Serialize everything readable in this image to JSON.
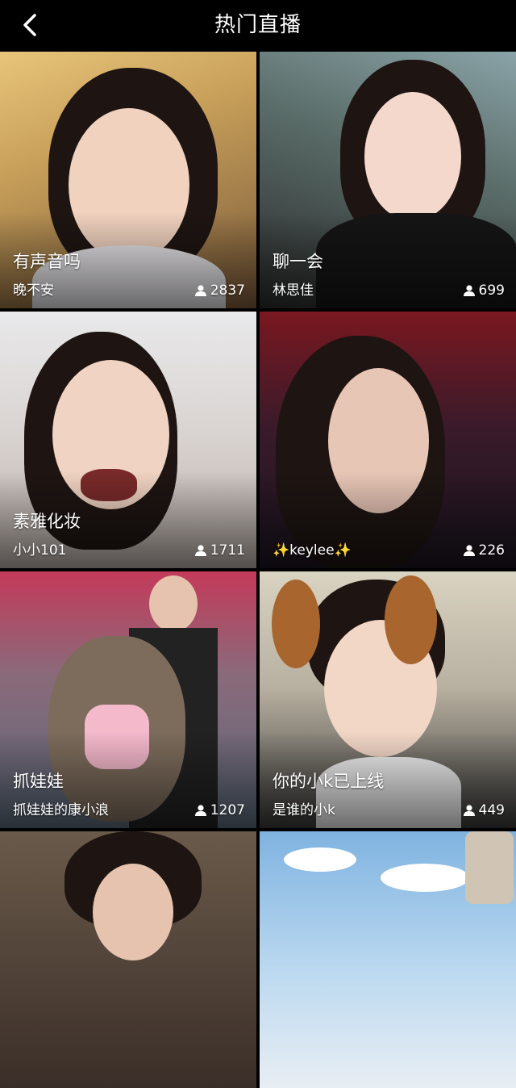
{
  "header": {
    "title": "热门直播",
    "back_icon": "chevron-left-icon"
  },
  "cards": [
    {
      "title": "有声音吗",
      "host": "晚不安",
      "viewers": "2837"
    },
    {
      "title": "聊一会",
      "host": "林思佳",
      "viewers": "699"
    },
    {
      "title": "素雅化妆",
      "host": "小小101",
      "viewers": "1711"
    },
    {
      "title": "",
      "host": "✨keylee✨",
      "viewers": "226"
    },
    {
      "title": "抓娃娃",
      "host": "抓娃娃的康小浪",
      "viewers": "1207"
    },
    {
      "title": "你的小k已上线",
      "host": "是谁的小k",
      "viewers": "449"
    },
    {
      "title": "",
      "host": "",
      "viewers": ""
    },
    {
      "title": "",
      "host": "",
      "viewers": ""
    }
  ],
  "colors": {
    "background": "#000000",
    "text": "#ffffff"
  }
}
